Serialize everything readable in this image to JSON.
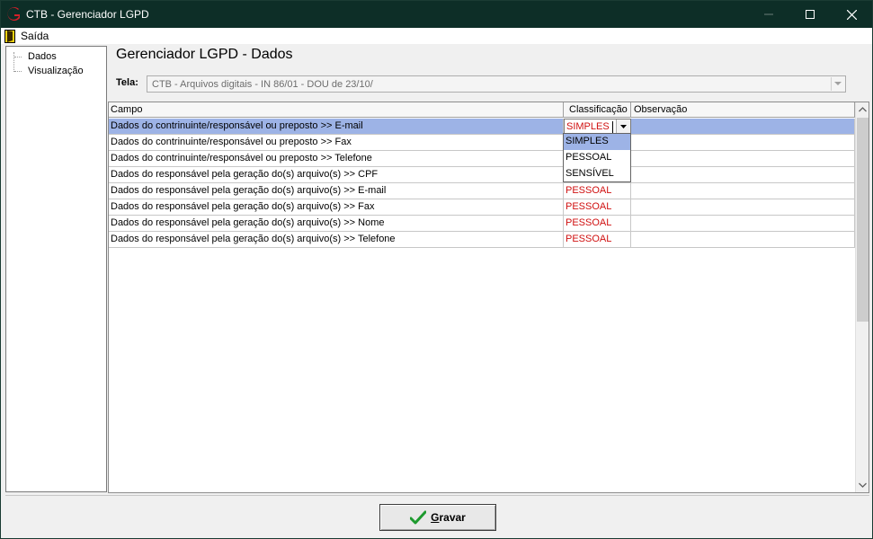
{
  "window": {
    "title": "CTB - Gerenciador LGPD"
  },
  "menu": {
    "exit_label": "Saída"
  },
  "tree": {
    "items": [
      "Dados",
      "Visualização"
    ]
  },
  "page": {
    "title": "Gerenciador LGPD - Dados"
  },
  "tela": {
    "label": "Tela:",
    "value": "CTB - Arquivos digitais - IN 86/01 - DOU de 23/10/"
  },
  "grid": {
    "columns": [
      "Campo",
      "Classificação",
      "Observação"
    ],
    "rows": [
      {
        "campo": "Dados do contrinuinte/responsável ou preposto >> E-mail",
        "classificacao": "SIMPLES",
        "observacao": ""
      },
      {
        "campo": "Dados do contrinuinte/responsável ou preposto >> Fax",
        "classificacao": "",
        "observacao": ""
      },
      {
        "campo": "Dados do contrinuinte/responsável ou preposto >> Telefone",
        "classificacao": "",
        "observacao": ""
      },
      {
        "campo": "Dados do responsável pela geração do(s) arquivo(s) >> CPF",
        "classificacao": "",
        "observacao": ""
      },
      {
        "campo": "Dados do responsável pela geração do(s) arquivo(s) >> E-mail",
        "classificacao": "PESSOAL",
        "observacao": ""
      },
      {
        "campo": "Dados do responsável pela geração do(s) arquivo(s) >> Fax",
        "classificacao": "PESSOAL",
        "observacao": ""
      },
      {
        "campo": "Dados do responsável pela geração do(s) arquivo(s) >> Nome",
        "classificacao": "PESSOAL",
        "observacao": ""
      },
      {
        "campo": "Dados do responsável pela geração do(s) arquivo(s) >> Telefone",
        "classificacao": "PESSOAL",
        "observacao": ""
      }
    ],
    "dropdown_options": [
      "SIMPLES",
      "PESSOAL",
      "SENSÍVEL"
    ],
    "dropdown_highlighted": "SIMPLES"
  },
  "buttons": {
    "save_label": "Gravar"
  },
  "colors": {
    "titlebar": "#0d2e27",
    "selection": "#9db3e6",
    "classification_text": "#d01010"
  }
}
